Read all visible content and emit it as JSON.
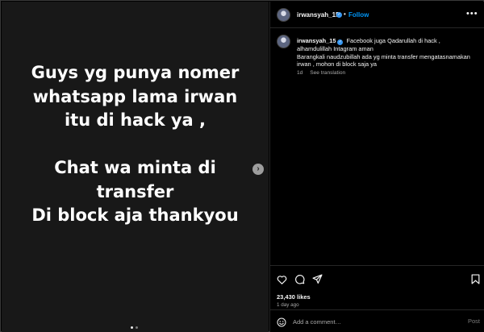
{
  "media": {
    "lines": [
      "Guys yg punya nomer",
      "whatsapp lama irwan",
      "itu di hack ya ,",
      "",
      "Chat wa minta di",
      "transfer",
      "Di block aja thankyou"
    ],
    "next_glyph": "›",
    "dots_total": 2,
    "dots_active": 1
  },
  "header": {
    "username": "irwansyah_15",
    "verified_mark": "✓",
    "separator": "•",
    "follow_label": "Follow",
    "more_glyph": "•••"
  },
  "caption": {
    "username": "irwansyah_15",
    "verified_mark": "✓",
    "line1": "Facebook juga Qadarullah di hack ,",
    "line2": "alhamdulillah Intagram aman",
    "line3": "Barangkali naudzubillah ada yg minta transfer mengatasnamakan",
    "line4": "irwan , mohon di block saja ya",
    "age": "1d",
    "translate_label": "See translation"
  },
  "stats": {
    "likes": "23,430 likes",
    "time": "1 day ago"
  },
  "comment": {
    "placeholder": "Add a comment…",
    "post_label": "Post"
  },
  "icons": [
    "like-icon",
    "comment-icon",
    "share-icon",
    "save-icon",
    "emoji-icon",
    "more-icon",
    "next-arrow-icon"
  ]
}
